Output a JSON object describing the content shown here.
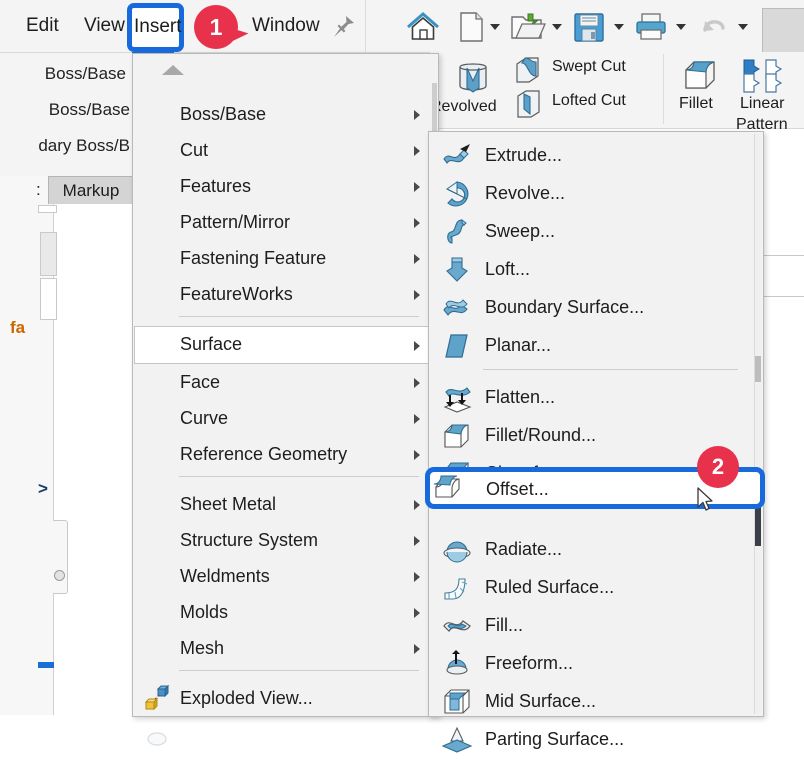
{
  "app": {
    "menubar": {
      "items": [
        {
          "label": "Edit"
        },
        {
          "label": "View"
        },
        {
          "label": "Insert"
        },
        {
          "label": "Window"
        }
      ],
      "pin_icon": "pin-icon"
    },
    "quick_toolbar": {
      "icons": [
        {
          "name": "home-icon"
        },
        {
          "name": "new-document-icon"
        },
        {
          "name": "open-folder-icon"
        },
        {
          "name": "save-icon"
        },
        {
          "name": "print-icon"
        },
        {
          "name": "undo-icon"
        }
      ]
    },
    "background_toolbar": {
      "lines": [
        "Boss/Base",
        "Boss/Base",
        "dary Boss/B"
      ]
    },
    "left_panel": {
      "tab_label": "Markup",
      "colon": ":",
      "fa_text": "fa",
      "gt_text": ">"
    },
    "ribbon": {
      "buttons": [
        {
          "label": "Revolved",
          "icon": "revolved-boss-icon"
        },
        {
          "label": "Swept Cut",
          "icon": "swept-cut-icon"
        },
        {
          "label": "Lofted Cut",
          "icon": "lofted-cut-icon"
        },
        {
          "label": "Fillet",
          "icon": "fillet-icon"
        },
        {
          "label": "Linear",
          "icon": "linear-pattern-icon"
        },
        {
          "label": "Pattern",
          "icon": "linear-pattern-icon"
        }
      ]
    }
  },
  "insert_menu": {
    "scroll_up_icon": "scroll-up-arrow-icon",
    "selected": "Surface",
    "items": [
      {
        "label": "Boss/Base",
        "submenu": true
      },
      {
        "label": "Cut",
        "submenu": true
      },
      {
        "label": "Features",
        "submenu": true
      },
      {
        "label": "Pattern/Mirror",
        "submenu": true
      },
      {
        "label": "Fastening Feature",
        "submenu": true
      },
      {
        "label": "FeatureWorks",
        "submenu": true
      },
      {
        "label": "Surface",
        "submenu": true
      },
      {
        "label": "Face",
        "submenu": true
      },
      {
        "label": "Curve",
        "submenu": true
      },
      {
        "label": "Reference Geometry",
        "submenu": true
      },
      {
        "label": "Sheet Metal",
        "submenu": true
      },
      {
        "label": "Structure System",
        "submenu": true
      },
      {
        "label": "Weldments",
        "submenu": true
      },
      {
        "label": "Molds",
        "submenu": true
      },
      {
        "label": "Mesh",
        "submenu": true
      },
      {
        "label": "Exploded View...",
        "submenu": false,
        "icon": "exploded-view-icon"
      }
    ]
  },
  "surface_submenu": {
    "highlighted": "Offset...",
    "items": [
      {
        "label": "Extrude...",
        "icon": "surface-extrude-icon"
      },
      {
        "label": "Revolve...",
        "icon": "surface-revolve-icon"
      },
      {
        "label": "Sweep...",
        "icon": "surface-sweep-icon"
      },
      {
        "label": "Loft...",
        "icon": "surface-loft-icon"
      },
      {
        "label": "Boundary Surface...",
        "icon": "boundary-surface-icon"
      },
      {
        "label": "Planar...",
        "icon": "planar-surface-icon"
      },
      {
        "label": "Flatten...",
        "icon": "flatten-icon"
      },
      {
        "label": "Fillet/Round...",
        "icon": "fillet-round-icon"
      },
      {
        "label": "Chamfer...",
        "icon": "chamfer-icon"
      },
      {
        "label": "Offset...",
        "icon": "offset-surface-icon"
      },
      {
        "label": "Radiate...",
        "icon": "radiate-surface-icon"
      },
      {
        "label": "Ruled Surface...",
        "icon": "ruled-surface-icon"
      },
      {
        "label": "Fill...",
        "icon": "fill-surface-icon"
      },
      {
        "label": "Freeform...",
        "icon": "freeform-icon"
      },
      {
        "label": "Mid Surface...",
        "icon": "mid-surface-icon"
      },
      {
        "label": "Parting Surface...",
        "icon": "parting-surface-icon"
      }
    ]
  },
  "annotations": {
    "step1": {
      "number": "1",
      "target": "Insert"
    },
    "step2": {
      "number": "2",
      "target": "Offset..."
    },
    "highlight_color": "#1769dc",
    "badge_color": "#e8314a"
  }
}
